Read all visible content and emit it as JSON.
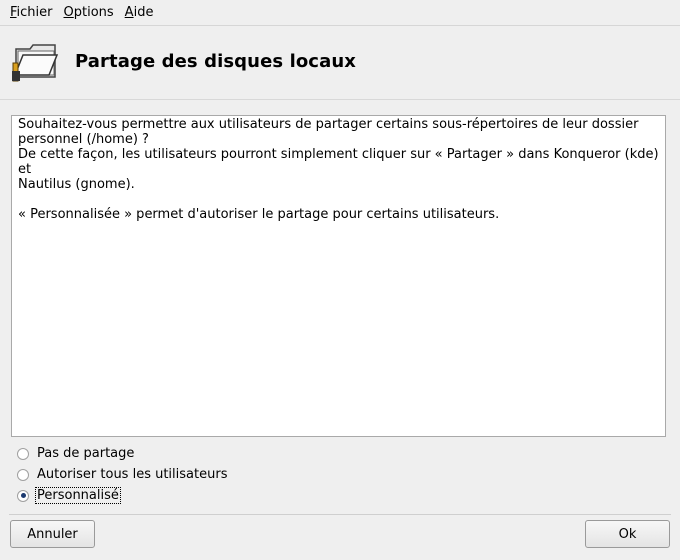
{
  "menubar": {
    "items": [
      {
        "mnemonic": "F",
        "rest": "ichier"
      },
      {
        "mnemonic": "O",
        "rest": "ptions"
      },
      {
        "mnemonic": "A",
        "rest": "ide"
      }
    ]
  },
  "header": {
    "icon": "folder-share-icon",
    "title": "Partage des disques locaux"
  },
  "description": {
    "line1": "Souhaitez-vous permettre aux utilisateurs de partager certains sous-répertoires de leur dossier",
    "line2": "personnel (/home) ?",
    "line3": "De cette façon, les utilisateurs pourront simplement cliquer sur « Partager » dans Konqueror (kde) et",
    "line4": "Nautilus (gnome).",
    "line5": "« Personnalisée » permet d'autoriser le partage pour certains utilisateurs."
  },
  "options": {
    "items": [
      {
        "label": "Pas de partage",
        "checked": false
      },
      {
        "label": "Autoriser tous les utilisateurs",
        "checked": false
      },
      {
        "label": "Personnalisé",
        "checked": true
      }
    ]
  },
  "buttons": {
    "cancel": "Annuler",
    "ok": "Ok"
  }
}
